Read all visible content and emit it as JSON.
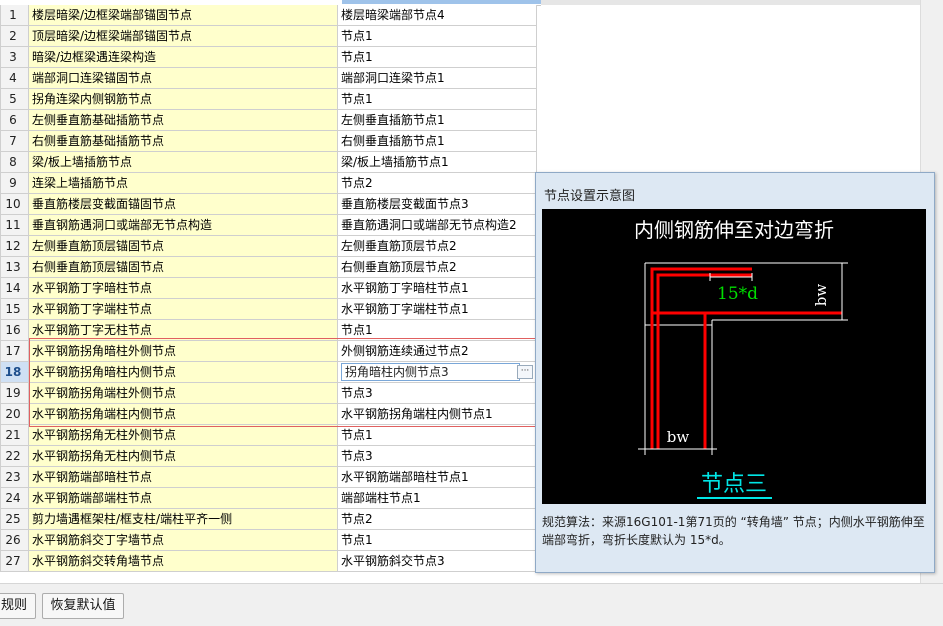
{
  "rows": [
    {
      "num": "1",
      "name": "楼层暗梁/边框梁端部锚固节点",
      "value": "楼层暗梁端部节点4"
    },
    {
      "num": "2",
      "name": "顶层暗梁/边框梁端部锚固节点",
      "value": "节点1"
    },
    {
      "num": "3",
      "name": "暗梁/边框梁遇连梁构造",
      "value": "节点1"
    },
    {
      "num": "4",
      "name": "端部洞口连梁锚固节点",
      "value": "端部洞口连梁节点1"
    },
    {
      "num": "5",
      "name": "拐角连梁内侧钢筋节点",
      "value": "节点1"
    },
    {
      "num": "6",
      "name": "左侧垂直筋基础插筋节点",
      "value": "左侧垂直插筋节点1"
    },
    {
      "num": "7",
      "name": "右侧垂直筋基础插筋节点",
      "value": "右侧垂直插筋节点1"
    },
    {
      "num": "8",
      "name": "梁/板上墙插筋节点",
      "value": "梁/板上墙插筋节点1"
    },
    {
      "num": "9",
      "name": "连梁上墙插筋节点",
      "value": "节点2"
    },
    {
      "num": "10",
      "name": "垂直筋楼层变截面锚固节点",
      "value": "垂直筋楼层变截面节点3"
    },
    {
      "num": "11",
      "name": "垂直钢筋遇洞口或端部无节点构造",
      "value": "垂直筋遇洞口或端部无节点构造2"
    },
    {
      "num": "12",
      "name": "左侧垂直筋顶层锚固节点",
      "value": "左侧垂直筋顶层节点2"
    },
    {
      "num": "13",
      "name": "右侧垂直筋顶层锚固节点",
      "value": "右侧垂直筋顶层节点2"
    },
    {
      "num": "14",
      "name": "水平钢筋丁字暗柱节点",
      "value": "水平钢筋丁字暗柱节点1"
    },
    {
      "num": "15",
      "name": "水平钢筋丁字端柱节点",
      "value": "水平钢筋丁字端柱节点1"
    },
    {
      "num": "16",
      "name": "水平钢筋丁字无柱节点",
      "value": "节点1"
    },
    {
      "num": "17",
      "name": "水平钢筋拐角暗柱外侧节点",
      "value": "外侧钢筋连续通过节点2"
    },
    {
      "num": "18",
      "name": "水平钢筋拐角暗柱内侧节点",
      "value": "拐角暗柱内侧节点3"
    },
    {
      "num": "19",
      "name": "水平钢筋拐角端柱外侧节点",
      "value": "节点3"
    },
    {
      "num": "20",
      "name": "水平钢筋拐角端柱内侧节点",
      "value": "水平钢筋拐角端柱内侧节点1"
    },
    {
      "num": "21",
      "name": "水平钢筋拐角无柱外侧节点",
      "value": "节点1"
    },
    {
      "num": "22",
      "name": "水平钢筋拐角无柱内侧节点",
      "value": "节点3"
    },
    {
      "num": "23",
      "name": "水平钢筋端部暗柱节点",
      "value": "水平钢筋端部暗柱节点1"
    },
    {
      "num": "24",
      "name": "水平钢筋端部端柱节点",
      "value": "端部端柱节点1"
    },
    {
      "num": "25",
      "name": "剪力墙遇框架柱/框支柱/端柱平齐一侧",
      "value": "节点2"
    },
    {
      "num": "26",
      "name": "水平钢筋斜交丁字墙节点",
      "value": "节点1"
    },
    {
      "num": "27",
      "name": "水平钢筋斜交转角墙节点",
      "value": "水平钢筋斜交节点3"
    }
  ],
  "selected_row": "18",
  "edit_button_label": "···",
  "panel": {
    "title": "节点设置示意图",
    "diagram_title": "内侧钢筋伸至对边弯折",
    "label_15d": "15*d",
    "label_bw_right": "bw",
    "label_bw_bottom": "bw",
    "node_label": "节点三",
    "description": "规范算法：来源16G101-1第71页的 “转角墙” 节点；内侧水平钢筋伸至端部弯折，弯折长度默认为 15*d。"
  },
  "bottom": {
    "rules_button_label": "规则",
    "restore_button_label": "恢复默认值"
  },
  "colors": {
    "name_cell_bg": "#ffffcc",
    "rebar_red": "#ff0000",
    "dim_green": "#00dd00",
    "node_cyan": "#00e5e5",
    "highlight_border": "#e06060"
  }
}
